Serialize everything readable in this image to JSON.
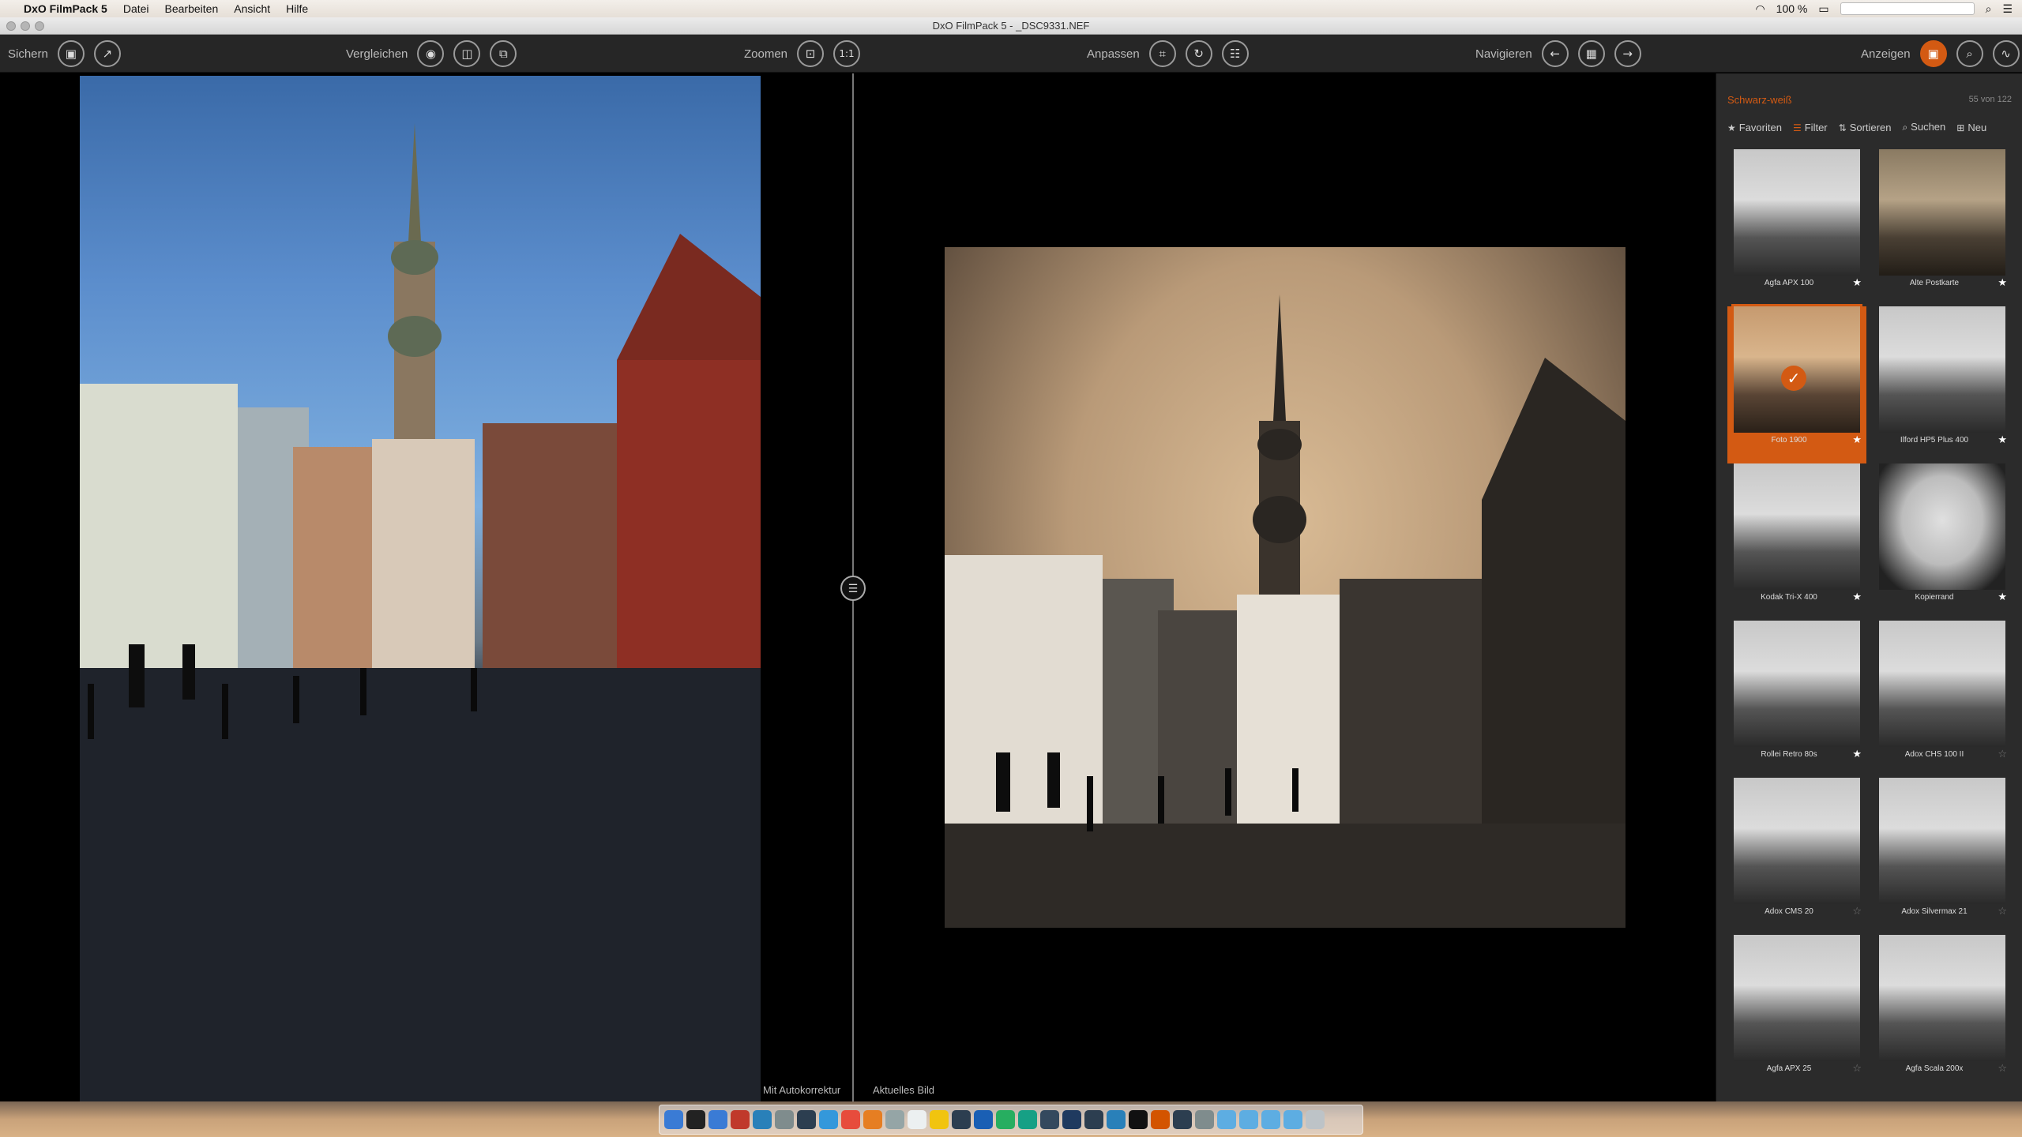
{
  "menubar": {
    "apple": "",
    "app": "DxO FilmPack 5",
    "items": [
      "Datei",
      "Bearbeiten",
      "Ansicht",
      "Hilfe"
    ],
    "battery": "100 %"
  },
  "window": {
    "title": "DxO FilmPack 5 - _DSC9331.NEF"
  },
  "toolbar": {
    "save": "Sichern",
    "compare": "Vergleichen",
    "zoom": "Zoomen",
    "zoom_one": "1:1",
    "adjust": "Anpassen",
    "navigate": "Navigieren",
    "view": "Anzeigen"
  },
  "viewer": {
    "left_caption": "Mit Autokorrektur",
    "right_caption": "Aktuelles Bild"
  },
  "panel": {
    "category": "Schwarz-weiß",
    "count": "55 von 122",
    "tools": [
      "Favoriten",
      "Filter",
      "Sortieren",
      "Suchen",
      "Neu"
    ],
    "presets": [
      {
        "name": "Agfa APX 100",
        "fav": true
      },
      {
        "name": "Alte Postkarte",
        "fav": true
      },
      {
        "name": "Foto 1900",
        "fav": true,
        "selected": true
      },
      {
        "name": "Ilford HP5 Plus 400",
        "fav": true
      },
      {
        "name": "Kodak Tri-X 400",
        "fav": true
      },
      {
        "name": "Kopierrand",
        "fav": true
      },
      {
        "name": "Rollei Retro 80s",
        "fav": true
      },
      {
        "name": "Adox CHS 100 II",
        "fav": false
      },
      {
        "name": "Adox CMS 20",
        "fav": false
      },
      {
        "name": "Adox Silvermax 21",
        "fav": false
      },
      {
        "name": "Agfa APX 25",
        "fav": false
      },
      {
        "name": "Agfa Scala 200x",
        "fav": false
      }
    ]
  },
  "colors": {
    "accent": "#d35a13"
  }
}
